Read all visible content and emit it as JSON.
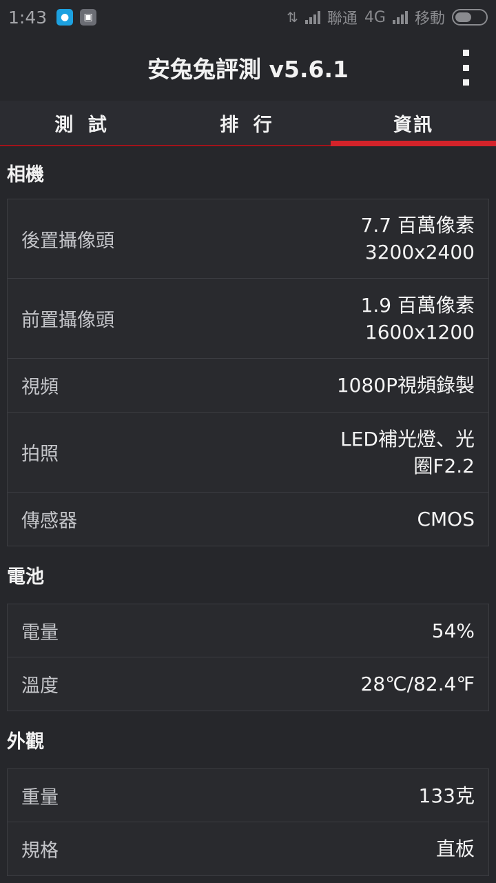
{
  "status_bar": {
    "time": "1:43",
    "carrier1": "聯通",
    "network": "4G",
    "carrier2": "移動"
  },
  "app": {
    "title": "安兔兔評測 v5.6.1"
  },
  "tabs": [
    {
      "label": "測 試",
      "active": false
    },
    {
      "label": "排 行",
      "active": false
    },
    {
      "label": "資訊",
      "active": true
    }
  ],
  "sections": {
    "camera": {
      "title": "相機",
      "rows": [
        {
          "label": "後置攝像頭",
          "value": "7.7 百萬像素\n3200x2400"
        },
        {
          "label": "前置攝像頭",
          "value": "1.9 百萬像素\n1600x1200"
        },
        {
          "label": "視頻",
          "value": "1080P視頻錄製"
        },
        {
          "label": "拍照",
          "value": "LED補光燈、光圈F2.2"
        },
        {
          "label": "傳感器",
          "value": "CMOS"
        }
      ]
    },
    "battery": {
      "title": "電池",
      "rows": [
        {
          "label": "電量",
          "value": "54%"
        },
        {
          "label": "溫度",
          "value": "28℃/82.4℉"
        }
      ]
    },
    "appearance": {
      "title": "外觀",
      "rows": [
        {
          "label": "重量",
          "value": "133克"
        },
        {
          "label": "規格",
          "value": "直板"
        }
      ]
    }
  },
  "colors": {
    "background": "#26272b",
    "accent": "#d4232a",
    "notif_blue": "#1da1e0"
  },
  "icons": {
    "notification1": "droplet-icon",
    "notification2": "app-icon",
    "menu": "more-vertical-icon"
  }
}
